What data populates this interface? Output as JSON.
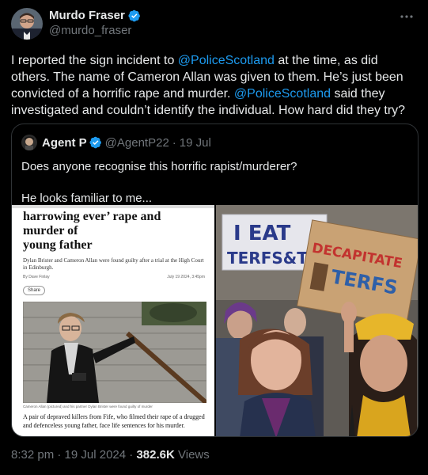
{
  "author": {
    "display_name": "Murdo Fraser",
    "handle": "@murdo_fraser"
  },
  "more_label": "···",
  "post_text": {
    "part1": "I reported the sign incident to ",
    "mention1": "@PoliceScotland",
    "part2": " at the time, as did others. The name of Cameron Allan was given to them. He’s just been convicted of a horrific rape and murder. ",
    "mention2": "@PoliceScotland",
    "part3": " said they investigated and couldn’t identify the individual. How hard did they try?"
  },
  "quote": {
    "display_name": "Agent P",
    "handle": "@AgentP22",
    "dot": "·",
    "date": "19 Jul",
    "line1": "Does anyone recognise this horrific rapist/murderer?",
    "line2": "He looks familiar to me..."
  },
  "article": {
    "headline_line1": "harrowing ever’ rape and murder of",
    "headline_line2": "young father",
    "standfirst": "Dylan Brister and Cameron Allan were found guilty after a trial at the High Court in Edinburgh.",
    "byline": "By Dave Finlay",
    "timestamp": "July 19 2024, 3:45pm",
    "share_label": "Share",
    "caption": "Cameron Allan (pictured) and his partner Dylan Brister were found guilty of murder",
    "foot": "A pair of depraved killers from Fife, who filmed their rape of a drugged and defenceless young father, face life sentences for his murder."
  },
  "protest_photo": {
    "sign1_line1": "I EAT",
    "sign1_line2": "TERFS&T",
    "sign2_line1": "DECAPITATE",
    "sign2_line2": "TERFS"
  },
  "stats": {
    "time": "8:32 pm",
    "dot1": "·",
    "date": "19 Jul 2024",
    "dot2": "·",
    "views_count": "382.6K",
    "views_label": "Views"
  },
  "colors": {
    "background": "#000000",
    "text": "#e7e9ea",
    "secondary": "#71767b",
    "link": "#1d9bf0",
    "verified_badge": "#1d9bf0",
    "border": "#2f3336"
  },
  "icons": {
    "verified": "verified-badge-icon",
    "more": "more-horizontal-icon"
  }
}
